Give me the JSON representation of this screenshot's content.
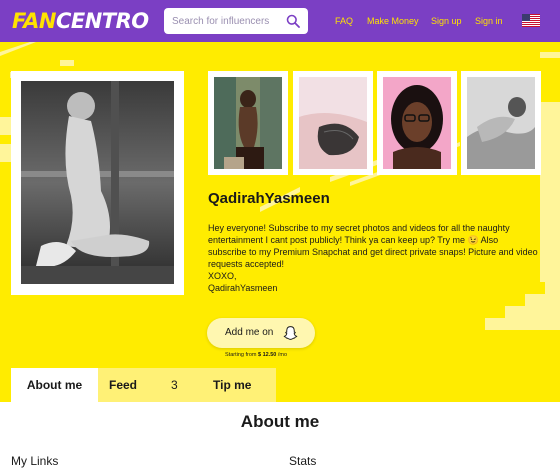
{
  "header": {
    "logo_fan": "FAN",
    "logo_centro": "CENTRO",
    "search_placeholder": "Search for influencers",
    "nav": [
      "FAQ",
      "Make Money",
      "Sign up",
      "Sign in"
    ],
    "flag": "us-flag-icon"
  },
  "profile": {
    "name": "QadirahYasmeen",
    "bio": "Hey everyone! Subscribe to my secret photos and videos for all the naughty entertainment I cant post publicly! Think ya can keep up? Try me 😉 Also subscribe to my Premium Snapchat and get direct private snaps! Picture and video requests accepted!\nXOXO,\nQadirahYasmeen",
    "add_button": "Add me on",
    "add_icon": "snapchat-ghost-icon",
    "starting_prefix": "Starting from",
    "starting_price": "$ 12.50",
    "starting_suffix": "/mo"
  },
  "tabs": {
    "about": "About me",
    "feed": "Feed",
    "feed_count": "3",
    "tip": "Tip me"
  },
  "main": {
    "title": "About me",
    "my_links": "My Links",
    "stats": "Stats"
  },
  "colors": {
    "header": "#7b3fc4",
    "accent": "#ffec00",
    "nav_text": "#ffe200"
  }
}
